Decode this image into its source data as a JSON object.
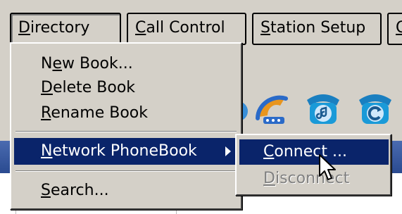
{
  "menubar": {
    "items": [
      {
        "prefix": "",
        "hotkey": "D",
        "rest": "irectory"
      },
      {
        "prefix": "",
        "hotkey": "C",
        "rest": "all Control"
      },
      {
        "prefix": "",
        "hotkey": "S",
        "rest": "tation Setup"
      },
      {
        "prefix": "",
        "hotkey": "O",
        "rest": ""
      }
    ]
  },
  "directory_menu": {
    "items": [
      {
        "prefix": "N",
        "hotkey": "e",
        "rest": "w Book..."
      },
      {
        "prefix": "",
        "hotkey": "D",
        "rest": "elete Book"
      },
      {
        "prefix": "",
        "hotkey": "R",
        "rest": "ename Book"
      },
      {
        "prefix": "",
        "hotkey": "N",
        "rest": "etwork PhoneBook"
      },
      {
        "prefix": "",
        "hotkey": "S",
        "rest": "earch..."
      }
    ]
  },
  "network_submenu": {
    "items": [
      {
        "prefix": "",
        "hotkey": "C",
        "rest": "onnect ...",
        "state": "highlighted"
      },
      {
        "prefix": "",
        "hotkey": "D",
        "rest": "isconnect",
        "state": "disabled"
      }
    ]
  },
  "colors": {
    "menu_bg": "#d4d0c8",
    "highlight": "#0a246a",
    "band": "#2a4a90"
  },
  "icons": [
    "phone-dial-icon",
    "phone-music-icon",
    "phone-redial-icon",
    "mouse-pointer-icon"
  ]
}
